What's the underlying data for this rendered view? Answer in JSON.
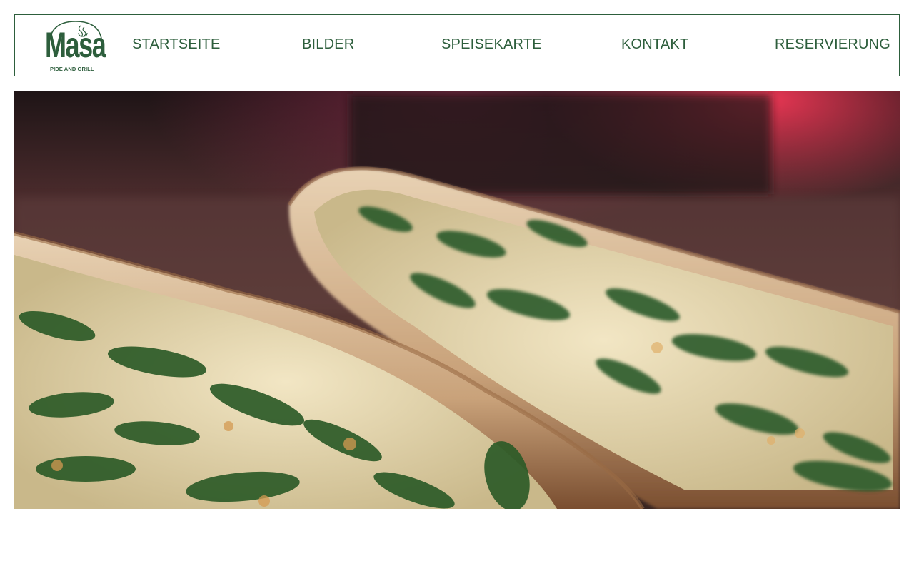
{
  "brand": {
    "name": "masa",
    "tagline": "PIDE AND GRILL",
    "color": "#2d5e3c"
  },
  "nav": {
    "items": [
      {
        "label": "STARTSEITE",
        "active": true
      },
      {
        "label": "BILDER",
        "active": false
      },
      {
        "label": "SPEISEKARTE",
        "active": false
      },
      {
        "label": "KONTAKT",
        "active": false
      },
      {
        "label": "RESERVIERUNG",
        "active": false
      }
    ]
  },
  "hero": {
    "icon": "pide-photo"
  }
}
